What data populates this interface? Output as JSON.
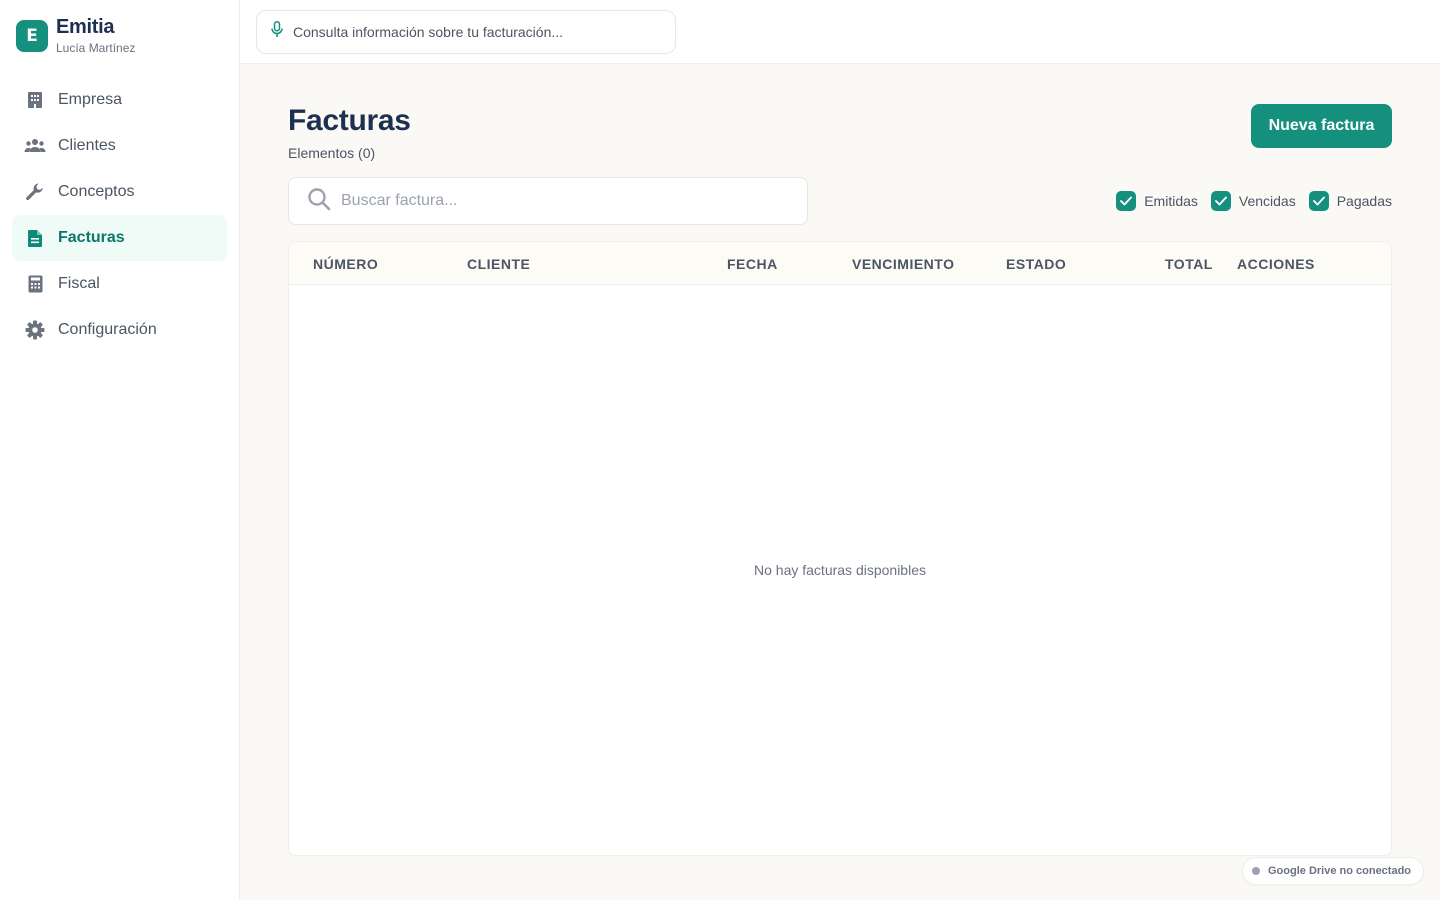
{
  "app": {
    "name": "Emitia",
    "logo_letter": "E",
    "user": "Lucía Martínez"
  },
  "sidebar": {
    "items": [
      {
        "label": "Empresa",
        "icon": "building-icon",
        "active": false
      },
      {
        "label": "Clientes",
        "icon": "users-icon",
        "active": false
      },
      {
        "label": "Conceptos",
        "icon": "wrench-icon",
        "active": false
      },
      {
        "label": "Facturas",
        "icon": "document-icon",
        "active": true
      },
      {
        "label": "Fiscal",
        "icon": "calculator-icon",
        "active": false
      },
      {
        "label": "Configuración",
        "icon": "gear-icon",
        "active": false
      }
    ]
  },
  "topbar": {
    "assistant_placeholder": "Consulta información sobre tu facturación...",
    "assistant_icon": "microphone-icon"
  },
  "page": {
    "title": "Facturas",
    "count_label": "Elementos (0)",
    "new_button": "Nueva factura",
    "search_placeholder": "Buscar factura..."
  },
  "filters": [
    {
      "label": "Emitidas",
      "checked": true
    },
    {
      "label": "Vencidas",
      "checked": true
    },
    {
      "label": "Pagadas",
      "checked": true
    }
  ],
  "table": {
    "columns": [
      "Número",
      "Cliente",
      "Fecha",
      "Vencimiento",
      "Estado",
      "Total",
      "Acciones"
    ],
    "rows": [],
    "empty_message": "No hay facturas disponibles"
  },
  "status": {
    "drive": "Google Drive no conectado"
  },
  "colors": {
    "accent": "#16907e",
    "active_bg": "#eefbf7",
    "title": "#1e3050"
  }
}
